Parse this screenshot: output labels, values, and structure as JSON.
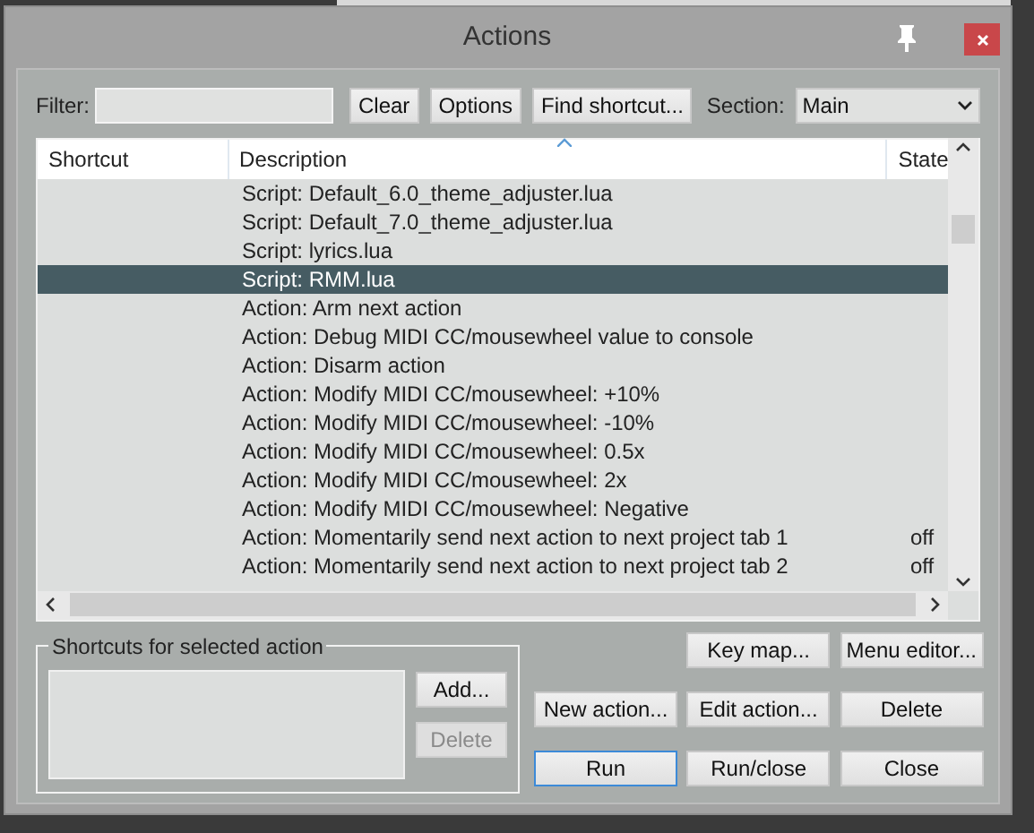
{
  "window": {
    "title": "Actions"
  },
  "filter": {
    "label": "Filter:"
  },
  "toolbar_buttons": [
    "Clear",
    "Options",
    "Find shortcut..."
  ],
  "section": {
    "label": "Section:",
    "value": "Main"
  },
  "table": {
    "columns": [
      "Shortcut",
      "Description",
      "State"
    ],
    "rows": [
      {
        "description": "Script: Default_6.0_theme_adjuster.lua",
        "selected": false
      },
      {
        "description": "Script: Default_7.0_theme_adjuster.lua",
        "selected": false
      },
      {
        "description": "Script: lyrics.lua",
        "selected": false
      },
      {
        "description": "Script: RMM.lua",
        "selected": true
      },
      {
        "description": "Action: Arm next action",
        "selected": false
      },
      {
        "description": "Action: Debug MIDI CC/mousewheel value to console",
        "selected": false
      },
      {
        "description": "Action: Disarm action",
        "selected": false
      },
      {
        "description": "Action: Modify MIDI CC/mousewheel: +10%",
        "selected": false
      },
      {
        "description": "Action: Modify MIDI CC/mousewheel: -10%",
        "selected": false
      },
      {
        "description": "Action: Modify MIDI CC/mousewheel: 0.5x",
        "selected": false
      },
      {
        "description": "Action: Modify MIDI CC/mousewheel: 2x",
        "selected": false
      },
      {
        "description": "Action: Modify MIDI CC/mousewheel: Negative",
        "selected": false
      },
      {
        "description": "Action: Momentarily send next action to next project tab 1",
        "state": "off",
        "selected": false
      },
      {
        "description": "Action: Momentarily send next action to next project tab 2",
        "state": "off",
        "selected": false
      }
    ]
  },
  "shortcuts_group": {
    "title": "Shortcuts for selected action",
    "buttons": [
      {
        "label": "Add...",
        "disabled": false
      },
      {
        "label": "Delete",
        "disabled": true
      }
    ]
  },
  "action_buttons": [
    {
      "label": "Key map...",
      "focused": false
    },
    {
      "label": "Menu editor...",
      "focused": false
    },
    {
      "label": "New action...",
      "focused": false
    },
    {
      "label": "Edit action...",
      "focused": false
    },
    {
      "label": "Delete",
      "focused": false
    },
    {
      "label": "Run",
      "focused": true
    },
    {
      "label": "Run/close",
      "focused": false
    },
    {
      "label": "Close",
      "focused": false
    }
  ]
}
